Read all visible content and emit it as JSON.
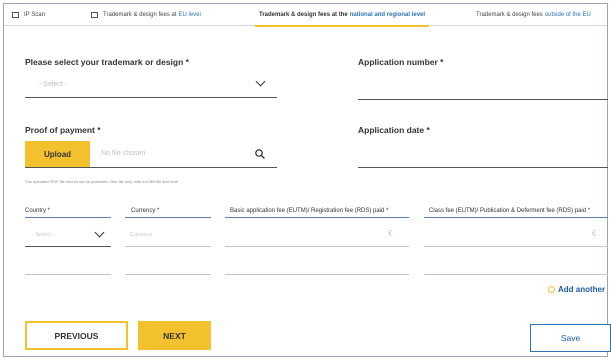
{
  "tabs": [
    {
      "label": "IP Scan",
      "highlight": ""
    },
    {
      "label": "Trademark & design fees at",
      "highlight": "EU level"
    },
    {
      "label": "Trademark & design fees at the",
      "highlight": "national and regional level"
    },
    {
      "label": "Trademark & design fees",
      "highlight": "outside of the EU"
    }
  ],
  "form": {
    "trademark_label": "Please select your trademark or design *",
    "trademark_value": "- Select -",
    "app_number_label": "Application number *",
    "proof_label": "Proof of payment *",
    "upload_label": "Upload",
    "no_file": "No file chosen",
    "file_note": "The uploaded PDF file should not be protected. One file only, with a 6 MB file size limit.",
    "app_date_label": "Application date *"
  },
  "fees_table": {
    "columns": [
      "Country *",
      "Currency *",
      "Basic application fee (EUTM)/ Registration fee (RDS) paid *",
      "Class fee (EUTM)/ Publication & Deferment fee (RDS) paid *"
    ],
    "row": {
      "country": "- Select -",
      "currency": "Currency",
      "basic_fee_unit": "€",
      "class_fee_unit": "€"
    }
  },
  "actions": {
    "add_another": "Add another",
    "previous": "PREVIOUS",
    "next": "NEXT",
    "save": "Save"
  },
  "colors": {
    "accent_yellow": "#f3c12d",
    "link_blue": "#1e5aa8"
  }
}
